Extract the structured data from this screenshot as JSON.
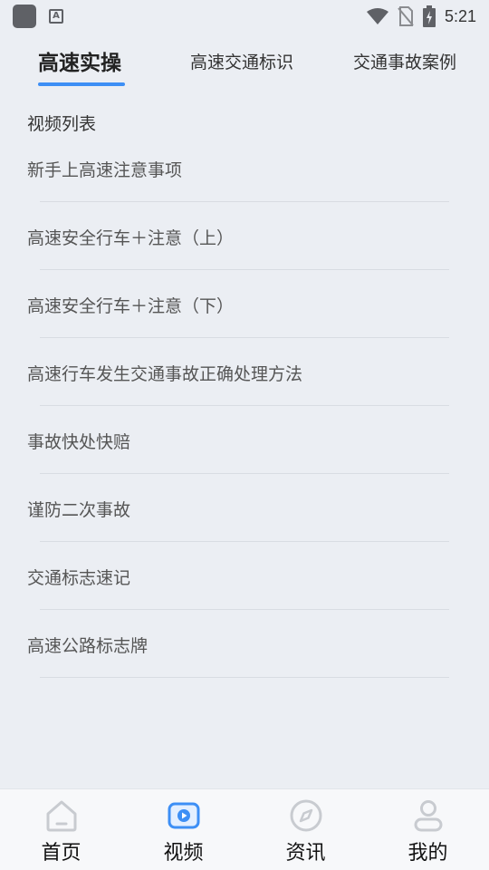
{
  "status_bar": {
    "time": "5:21",
    "app_icon_letter": "A"
  },
  "tabs": [
    {
      "label": "高速实操",
      "active": true
    },
    {
      "label": "高速交通标识",
      "active": false
    },
    {
      "label": "交通事故案例",
      "active": false
    }
  ],
  "section_title": "视频列表",
  "videos": [
    "新手上高速注意事项",
    "高速安全行车＋注意（上）",
    "高速安全行车＋注意（下）",
    "高速行车发生交通事故正确处理方法",
    "事故快处快赔",
    "谨防二次事故",
    "交通标志速记",
    "高速公路标志牌"
  ],
  "bottom_nav": [
    {
      "label": "首页",
      "icon": "home-icon"
    },
    {
      "label": "视频",
      "icon": "video-icon",
      "active": true
    },
    {
      "label": "资讯",
      "icon": "compass-icon"
    },
    {
      "label": "我的",
      "icon": "person-icon"
    }
  ],
  "colors": {
    "accent": "#3d8ff5",
    "background": "#ebeef3",
    "inactive_icon": "#c8cbd0"
  }
}
